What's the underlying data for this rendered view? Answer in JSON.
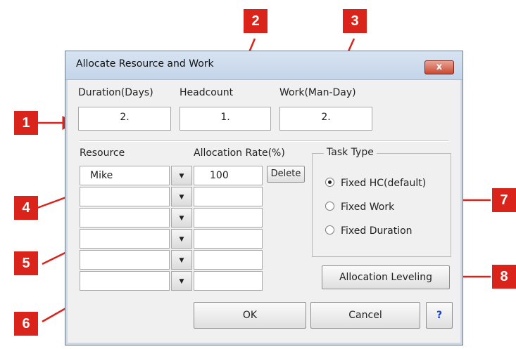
{
  "dialog": {
    "title": "Allocate Resource and Work",
    "close_label": "x"
  },
  "fields": {
    "duration": {
      "label": "Duration(Days)",
      "value": "2."
    },
    "headcount": {
      "label": "Headcount",
      "value": "1."
    },
    "work": {
      "label": "Work(Man-Day)",
      "value": "2."
    }
  },
  "resource": {
    "header": "Resource",
    "rows": [
      "Mike",
      "",
      "",
      "",
      "",
      ""
    ]
  },
  "allocation": {
    "header": "Allocation Rate(%)",
    "rows": [
      "100",
      "",
      "",
      "",
      "",
      ""
    ],
    "delete_label": "Delete"
  },
  "task_type": {
    "label": "Task Type",
    "options": [
      "Fixed HC(default)",
      "Fixed Work",
      "Fixed Duration"
    ],
    "selected": "Fixed HC(default)"
  },
  "buttons": {
    "leveling": "Allocation Leveling",
    "ok": "OK",
    "cancel": "Cancel",
    "help": "?"
  },
  "callouts": [
    "1",
    "2",
    "3",
    "4",
    "5",
    "6",
    "7",
    "8"
  ],
  "colors": {
    "callout": "#d9231b",
    "help": "#1a3fcf"
  }
}
